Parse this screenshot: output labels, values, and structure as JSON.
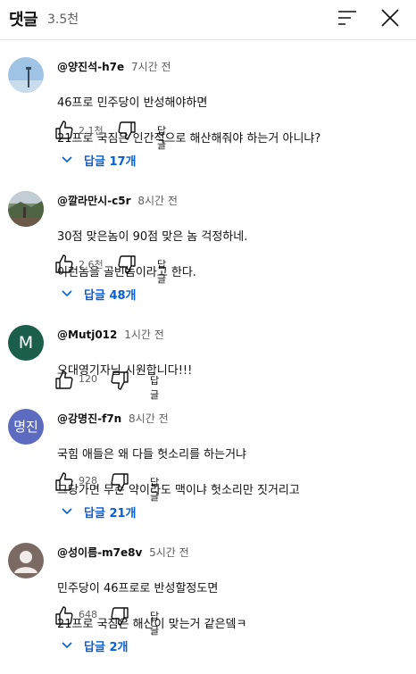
{
  "header": {
    "title": "댓글",
    "count": "3.5천"
  },
  "comments": [
    {
      "author": "@양진석-h7e",
      "time": "7시간 전",
      "line1": "46프로 민주당이 반성해야하면",
      "line2": "21프로 국짐은 인간적으로 해산해줘야 하는거 아니냐?",
      "likes": "2.1천",
      "reply_label": "답글",
      "replies": "답글 17개",
      "avatar_icon": "lamp-post-photo"
    },
    {
      "author": "@깔라만시-c5r",
      "time": "8시간 전",
      "line1": "30점 맞은놈이 90점 맞은 놈 걱정하네.",
      "line2": "이런놈을 골빈놈이라고 한다.",
      "likes": "2.6천",
      "reply_label": "답글",
      "replies": "답글 48개",
      "avatar_icon": "landscape-photo"
    },
    {
      "author": "@Mutj012",
      "time": "1시간 전",
      "line1": "오대영기자님 시원합니다!!!",
      "likes": "120",
      "reply_label": "답글",
      "avatar_letter": "M",
      "avatar_color": "#1b5e4b"
    },
    {
      "author": "@강명진-f7n",
      "time": "8시간 전",
      "line1": "국힘 애들은 왜 다들 헛소리를 하는거냐",
      "line2": "그당가면 무슨 약이라도 맥이냐 헛소리만 짓거리고",
      "likes": "928",
      "reply_label": "답글",
      "replies": "답글 21개",
      "avatar_letter": "명진",
      "avatar_color": "#5c6bc0"
    },
    {
      "author": "@성이름-m7e8v",
      "time": "5시간 전",
      "line1": "민주당이 46프로로 반성할정도면",
      "line2": "21프로 국짐은 해산이 맞는거 같은뎈ㅋ",
      "likes": "648",
      "reply_label": "답글",
      "replies": "답글 2개",
      "avatar_icon": "default-user"
    }
  ],
  "colors": {
    "link": "#065fd4",
    "secondary_text": "#606060"
  }
}
